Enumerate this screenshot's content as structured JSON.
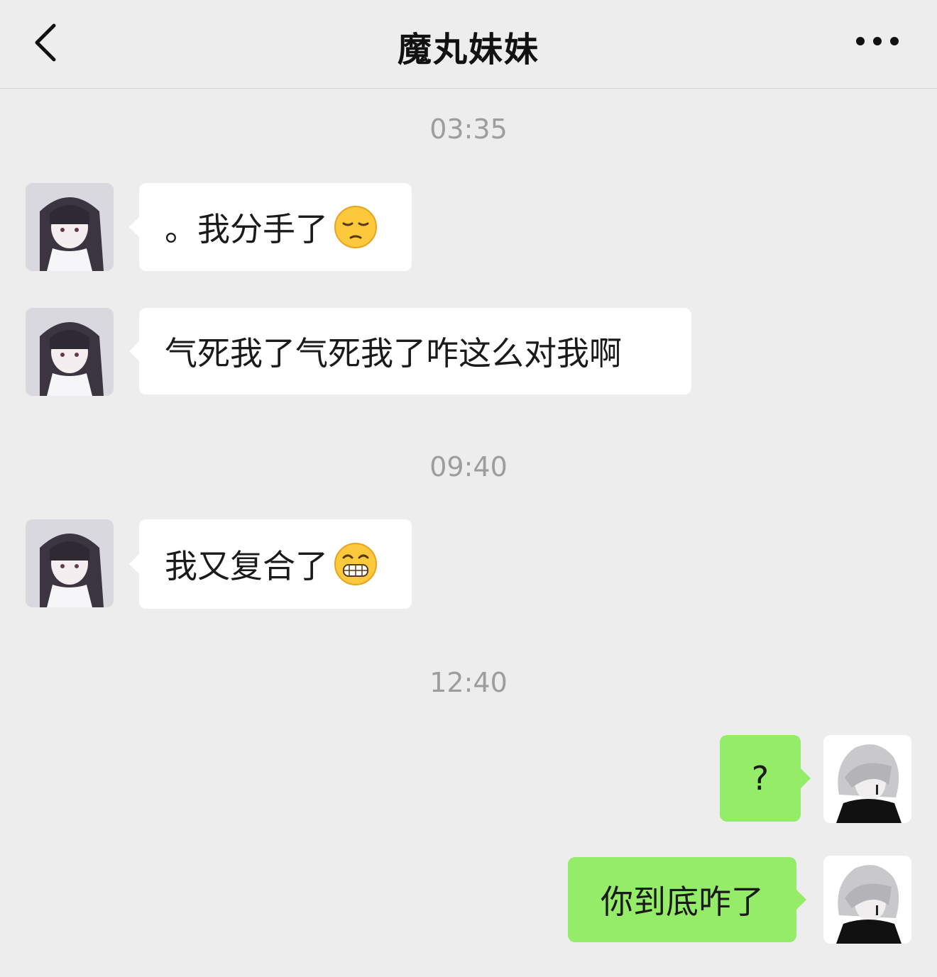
{
  "header": {
    "title": "魔丸妹妹",
    "back_icon": "chevron-left-icon",
    "more_icon": "more-horizontal-icon"
  },
  "messages": [
    {
      "timestamp": "03:35"
    },
    {
      "side": "left",
      "text": "。我分手了",
      "emoji": "pensive-face-emoji"
    },
    {
      "side": "left",
      "text": "气死我了气死我了咋这么对我啊"
    },
    {
      "timestamp": "09:40"
    },
    {
      "side": "left",
      "text": "我又复合了",
      "emoji": "grimacing-face-emoji"
    },
    {
      "timestamp": "12:40"
    },
    {
      "side": "right",
      "text": "?"
    },
    {
      "side": "right",
      "text": "你到底咋了"
    }
  ],
  "colors": {
    "background": "#ededed",
    "bubble_left": "#ffffff",
    "bubble_right": "#95ec69",
    "timestamp_text": "#9d9d9d"
  }
}
